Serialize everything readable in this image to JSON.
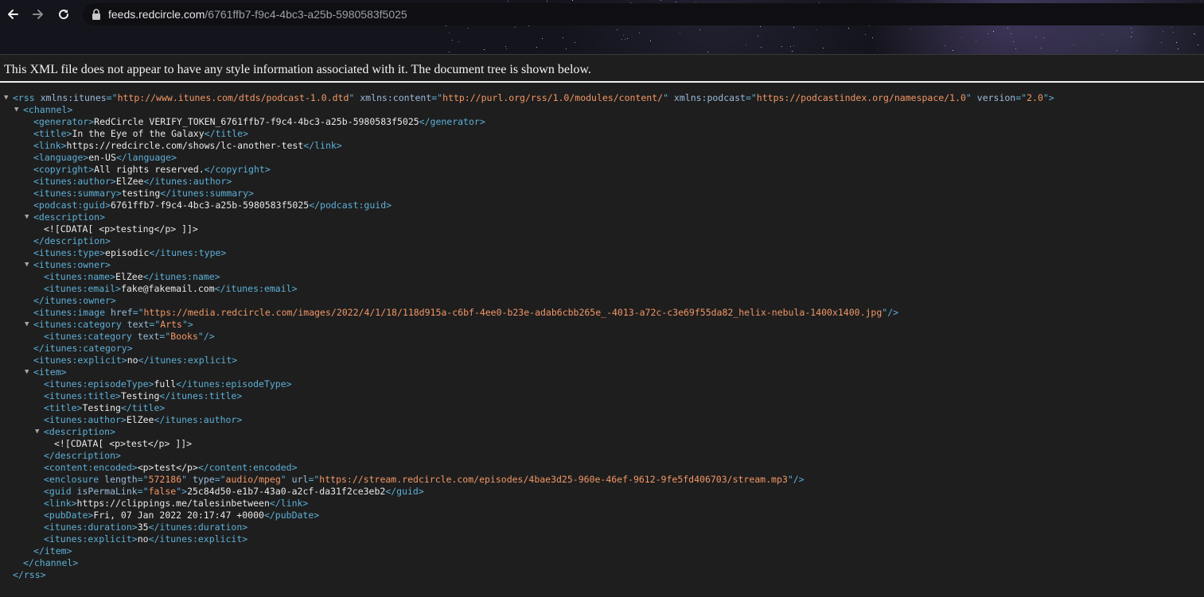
{
  "browser": {
    "url_host": "feeds.redcircle.com",
    "url_path": "/6761ffb7-f9c4-4bc3-a25b-5980583f5025"
  },
  "notice": "This XML file does not appear to have any style information associated with it. The document tree is shown below.",
  "tree": [
    {
      "d": 0,
      "t": true,
      "s": [
        [
          "tg",
          "<rss "
        ],
        [
          "an",
          "xmlns:itunes"
        ],
        [
          "tg",
          "=\""
        ],
        [
          "av",
          "http://www.itunes.com/dtds/podcast-1.0.dtd"
        ],
        [
          "tg",
          "\" "
        ],
        [
          "an",
          "xmlns:content"
        ],
        [
          "tg",
          "=\""
        ],
        [
          "av",
          "http://purl.org/rss/1.0/modules/content/"
        ],
        [
          "tg",
          "\" "
        ],
        [
          "an",
          "xmlns:podcast"
        ],
        [
          "tg",
          "=\""
        ],
        [
          "av",
          "https://podcastindex.org/namespace/1.0"
        ],
        [
          "tg",
          "\" "
        ],
        [
          "an",
          "version"
        ],
        [
          "tg",
          "=\""
        ],
        [
          "av",
          "2.0"
        ],
        [
          "tg",
          "\">"
        ]
      ]
    },
    {
      "d": 1,
      "t": true,
      "s": [
        [
          "tg",
          "<channel>"
        ]
      ]
    },
    {
      "d": 2,
      "s": [
        [
          "tg",
          "<generator>"
        ],
        [
          "tx",
          "RedCircle VERIFY_TOKEN_6761ffb7-f9c4-4bc3-a25b-5980583f5025"
        ],
        [
          "tg",
          "</generator>"
        ]
      ]
    },
    {
      "d": 2,
      "s": [
        [
          "tg",
          "<title>"
        ],
        [
          "tx",
          "In the Eye of the Galaxy"
        ],
        [
          "tg",
          "</title>"
        ]
      ]
    },
    {
      "d": 2,
      "s": [
        [
          "tg",
          "<link>"
        ],
        [
          "tx",
          "https://redcircle.com/shows/lc-another-test"
        ],
        [
          "tg",
          "</link>"
        ]
      ]
    },
    {
      "d": 2,
      "s": [
        [
          "tg",
          "<language>"
        ],
        [
          "tx",
          "en-US"
        ],
        [
          "tg",
          "</language>"
        ]
      ]
    },
    {
      "d": 2,
      "s": [
        [
          "tg",
          "<copyright>"
        ],
        [
          "tx",
          "All rights reserved."
        ],
        [
          "tg",
          "</copyright>"
        ]
      ]
    },
    {
      "d": 2,
      "s": [
        [
          "tg",
          "<itunes:author>"
        ],
        [
          "tx",
          "ElZee"
        ],
        [
          "tg",
          "</itunes:author>"
        ]
      ]
    },
    {
      "d": 2,
      "s": [
        [
          "tg",
          "<itunes:summary>"
        ],
        [
          "tx",
          "testing"
        ],
        [
          "tg",
          "</itunes:summary>"
        ]
      ]
    },
    {
      "d": 2,
      "s": [
        [
          "tg",
          "<podcast:guid>"
        ],
        [
          "tx",
          "6761ffb7-f9c4-4bc3-a25b-5980583f5025"
        ],
        [
          "tg",
          "</podcast:guid>"
        ]
      ]
    },
    {
      "d": 2,
      "t": true,
      "s": [
        [
          "tg",
          "<description>"
        ]
      ]
    },
    {
      "d": 3,
      "s": [
        [
          "tx",
          "<![CDATA[ <p>testing</p> ]]>"
        ]
      ]
    },
    {
      "d": 2,
      "s": [
        [
          "tg",
          "</description>"
        ]
      ]
    },
    {
      "d": 2,
      "s": [
        [
          "tg",
          "<itunes:type>"
        ],
        [
          "tx",
          "episodic"
        ],
        [
          "tg",
          "</itunes:type>"
        ]
      ]
    },
    {
      "d": 2,
      "t": true,
      "s": [
        [
          "tg",
          "<itunes:owner>"
        ]
      ]
    },
    {
      "d": 3,
      "s": [
        [
          "tg",
          "<itunes:name>"
        ],
        [
          "tx",
          "ElZee"
        ],
        [
          "tg",
          "</itunes:name>"
        ]
      ]
    },
    {
      "d": 3,
      "s": [
        [
          "tg",
          "<itunes:email>"
        ],
        [
          "tx",
          "fake@fakemail.com"
        ],
        [
          "tg",
          "</itunes:email>"
        ]
      ]
    },
    {
      "d": 2,
      "s": [
        [
          "tg",
          "</itunes:owner>"
        ]
      ]
    },
    {
      "d": 2,
      "s": [
        [
          "tg",
          "<itunes:image "
        ],
        [
          "an",
          "href"
        ],
        [
          "tg",
          "=\""
        ],
        [
          "av",
          "https://media.redcircle.com/images/2022/4/1/18/118d915a-c6bf-4ee0-b23e-adab6cbb265e_-4013-a72c-c3e69f55da82_helix-nebula-1400x1400.jpg"
        ],
        [
          "tg",
          "\"/>"
        ]
      ]
    },
    {
      "d": 2,
      "t": true,
      "s": [
        [
          "tg",
          "<itunes:category "
        ],
        [
          "an",
          "text"
        ],
        [
          "tg",
          "=\""
        ],
        [
          "av",
          "Arts"
        ],
        [
          "tg",
          "\">"
        ]
      ]
    },
    {
      "d": 3,
      "s": [
        [
          "tg",
          "<itunes:category "
        ],
        [
          "an",
          "text"
        ],
        [
          "tg",
          "=\""
        ],
        [
          "av",
          "Books"
        ],
        [
          "tg",
          "\"/>"
        ]
      ]
    },
    {
      "d": 2,
      "s": [
        [
          "tg",
          "</itunes:category>"
        ]
      ]
    },
    {
      "d": 2,
      "s": [
        [
          "tg",
          "<itunes:explicit>"
        ],
        [
          "tx",
          "no"
        ],
        [
          "tg",
          "</itunes:explicit>"
        ]
      ]
    },
    {
      "d": 2,
      "t": true,
      "s": [
        [
          "tg",
          "<item>"
        ]
      ]
    },
    {
      "d": 3,
      "s": [
        [
          "tg",
          "<itunes:episodeType>"
        ],
        [
          "tx",
          "full"
        ],
        [
          "tg",
          "</itunes:episodeType>"
        ]
      ]
    },
    {
      "d": 3,
      "s": [
        [
          "tg",
          "<itunes:title>"
        ],
        [
          "tx",
          "Testing"
        ],
        [
          "tg",
          "</itunes:title>"
        ]
      ]
    },
    {
      "d": 3,
      "s": [
        [
          "tg",
          "<title>"
        ],
        [
          "tx",
          "Testing"
        ],
        [
          "tg",
          "</title>"
        ]
      ]
    },
    {
      "d": 3,
      "s": [
        [
          "tg",
          "<itunes:author>"
        ],
        [
          "tx",
          "ElZee"
        ],
        [
          "tg",
          "</itunes:author>"
        ]
      ]
    },
    {
      "d": 3,
      "t": true,
      "s": [
        [
          "tg",
          "<description>"
        ]
      ]
    },
    {
      "d": 4,
      "s": [
        [
          "tx",
          "<![CDATA[ <p>test</p> ]]>"
        ]
      ]
    },
    {
      "d": 3,
      "s": [
        [
          "tg",
          "</description>"
        ]
      ]
    },
    {
      "d": 3,
      "s": [
        [
          "tg",
          "<content:encoded>"
        ],
        [
          "tx",
          "<p>test</p>"
        ],
        [
          "tg",
          "</content:encoded>"
        ]
      ]
    },
    {
      "d": 3,
      "s": [
        [
          "tg",
          "<enclosure "
        ],
        [
          "an",
          "length"
        ],
        [
          "tg",
          "=\""
        ],
        [
          "av",
          "572186"
        ],
        [
          "tg",
          "\" "
        ],
        [
          "an",
          "type"
        ],
        [
          "tg",
          "=\""
        ],
        [
          "av",
          "audio/mpeg"
        ],
        [
          "tg",
          "\" "
        ],
        [
          "an",
          "url"
        ],
        [
          "tg",
          "=\""
        ],
        [
          "av",
          "https://stream.redcircle.com/episodes/4bae3d25-960e-46ef-9612-9fe5fd406703/stream.mp3"
        ],
        [
          "tg",
          "\"/>"
        ]
      ]
    },
    {
      "d": 3,
      "s": [
        [
          "tg",
          "<guid "
        ],
        [
          "an",
          "isPermaLink"
        ],
        [
          "tg",
          "=\""
        ],
        [
          "av",
          "false"
        ],
        [
          "tg",
          "\">"
        ],
        [
          "tx",
          "25c84d50-e1b7-43a0-a2cf-da31f2ce3eb2"
        ],
        [
          "tg",
          "</guid>"
        ]
      ]
    },
    {
      "d": 3,
      "s": [
        [
          "tg",
          "<link>"
        ],
        [
          "tx",
          "https://clippings.me/talesinbetween"
        ],
        [
          "tg",
          "</link>"
        ]
      ]
    },
    {
      "d": 3,
      "s": [
        [
          "tg",
          "<pubDate>"
        ],
        [
          "tx",
          "Fri, 07 Jan 2022 20:17:47 +0000"
        ],
        [
          "tg",
          "</pubDate>"
        ]
      ]
    },
    {
      "d": 3,
      "s": [
        [
          "tg",
          "<itunes:duration>"
        ],
        [
          "tx",
          "35"
        ],
        [
          "tg",
          "</itunes:duration>"
        ]
      ]
    },
    {
      "d": 3,
      "s": [
        [
          "tg",
          "<itunes:explicit>"
        ],
        [
          "tx",
          "no"
        ],
        [
          "tg",
          "</itunes:explicit>"
        ]
      ]
    },
    {
      "d": 2,
      "s": [
        [
          "tg",
          "</item>"
        ]
      ]
    },
    {
      "d": 1,
      "s": [
        [
          "tg",
          "</channel>"
        ]
      ]
    },
    {
      "d": 0,
      "s": [
        [
          "tg",
          "</rss>"
        ]
      ]
    }
  ]
}
